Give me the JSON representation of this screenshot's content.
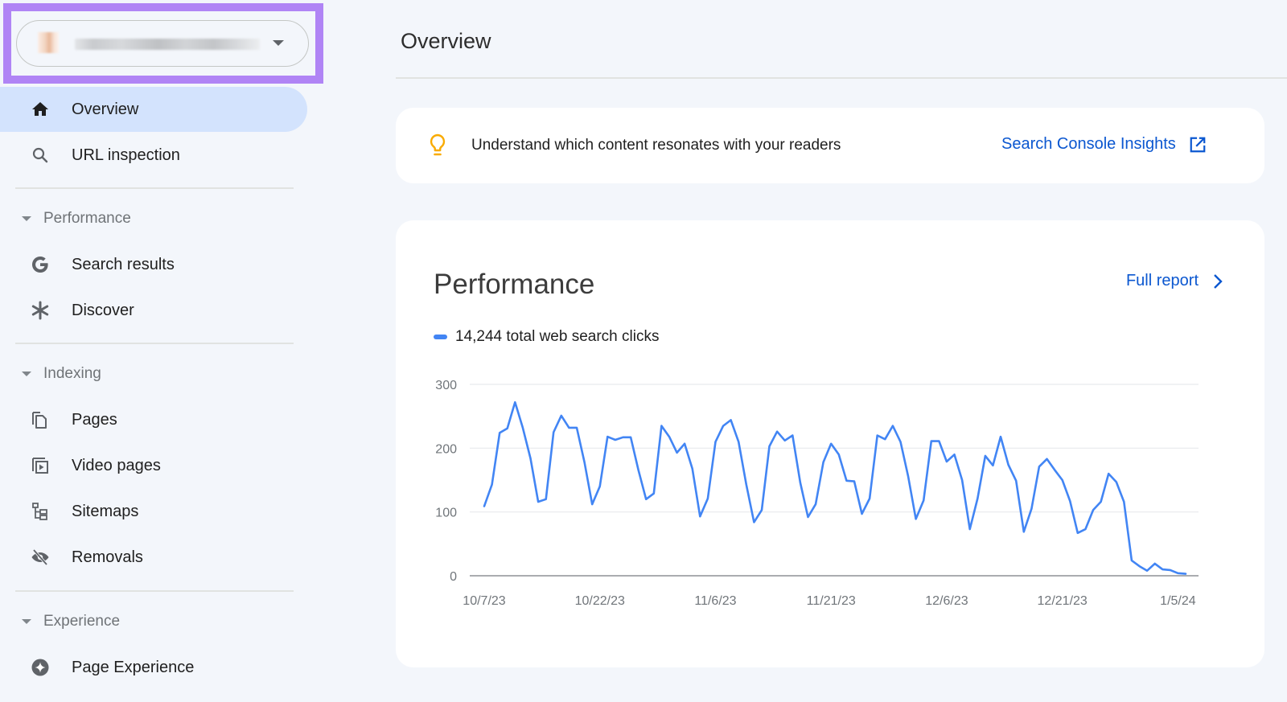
{
  "sidebar": {
    "property_selector": {
      "value": "(blurred property name)",
      "icon": "chevron-down-icon"
    },
    "items": [
      {
        "label": "Overview",
        "icon": "home-icon",
        "active": true
      },
      {
        "label": "URL inspection",
        "icon": "search-icon",
        "active": false
      }
    ],
    "sections": [
      {
        "label": "Performance",
        "items": [
          {
            "label": "Search results",
            "icon": "google-g-icon"
          },
          {
            "label": "Discover",
            "icon": "asterisk-icon"
          }
        ]
      },
      {
        "label": "Indexing",
        "items": [
          {
            "label": "Pages",
            "icon": "pages-icon"
          },
          {
            "label": "Video pages",
            "icon": "video-pages-icon"
          },
          {
            "label": "Sitemaps",
            "icon": "sitemap-icon"
          },
          {
            "label": "Removals",
            "icon": "eye-off-icon"
          }
        ]
      },
      {
        "label": "Experience",
        "items": [
          {
            "label": "Page Experience",
            "icon": "page-experience-icon"
          }
        ]
      }
    ]
  },
  "header": {
    "title": "Overview"
  },
  "insights": {
    "text": "Understand which content resonates with your readers",
    "link_label": "Search Console Insights",
    "icon": "lightbulb-icon",
    "link_icon": "open-in-new-icon",
    "icon_color": "#f9ab00",
    "link_color": "#0b57d0"
  },
  "performance": {
    "title": "Performance",
    "full_report_label": "Full report",
    "legend_label": "14,244 total web search clicks"
  },
  "chart_data": {
    "type": "line",
    "title": "Performance",
    "xlabel": "",
    "ylabel": "",
    "ylim": [
      0,
      300
    ],
    "yticks": [
      0,
      100,
      200,
      300
    ],
    "xtick_labels": [
      "10/7/23",
      "10/22/23",
      "11/6/23",
      "11/21/23",
      "12/6/23",
      "12/21/23",
      "1/5/24"
    ],
    "xtick_day_index": [
      0,
      15,
      30,
      45,
      60,
      75,
      90
    ],
    "grid": true,
    "legend_position": "top-left",
    "series": [
      {
        "name": "14,244 total web search clicks",
        "color": "#4285f4",
        "values": [
          109,
          143,
          224,
          231,
          272,
          232,
          184,
          116,
          120,
          225,
          251,
          232,
          232,
          178,
          112,
          140,
          218,
          213,
          217,
          217,
          166,
          120,
          129,
          235,
          218,
          193,
          207,
          168,
          93,
          121,
          210,
          235,
          244,
          210,
          143,
          84,
          103,
          203,
          226,
          212,
          220,
          146,
          92,
          112,
          178,
          207,
          190,
          149,
          148,
          97,
          121,
          220,
          214,
          235,
          210,
          156,
          89,
          118,
          211,
          211,
          179,
          190,
          150,
          73,
          121,
          188,
          173,
          218,
          174,
          149,
          69,
          105,
          171,
          183,
          166,
          150,
          117,
          67,
          73,
          103,
          116,
          160,
          147,
          116,
          24,
          15,
          8,
          19,
          10,
          9,
          4,
          3
        ]
      }
    ]
  }
}
